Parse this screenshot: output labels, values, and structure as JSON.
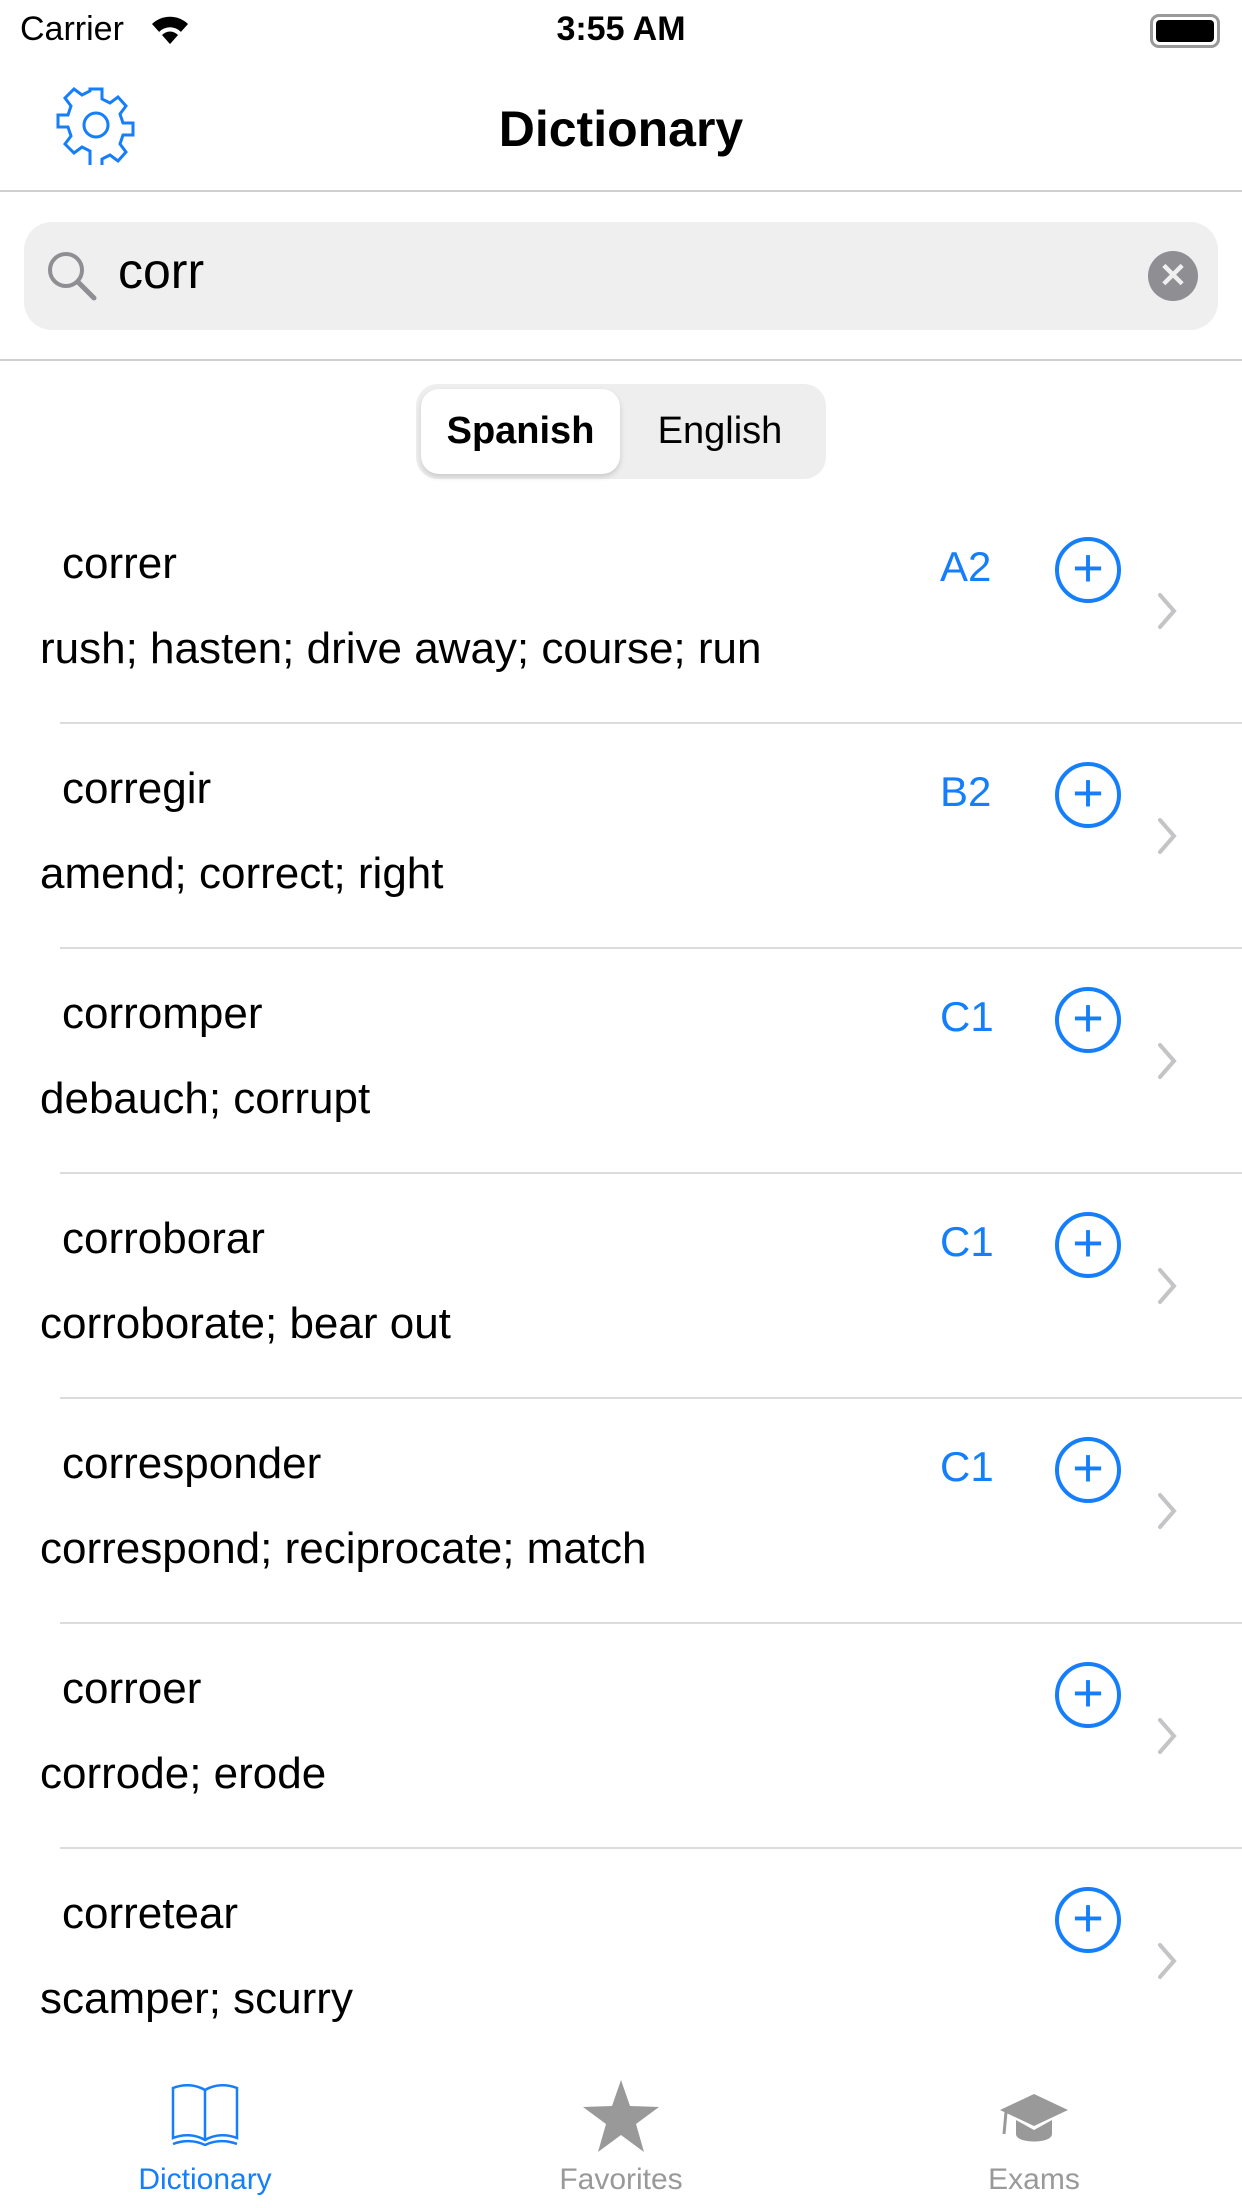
{
  "status": {
    "carrier": "Carrier",
    "time": "3:55 AM"
  },
  "nav": {
    "title": "Dictionary"
  },
  "search": {
    "value": "corr"
  },
  "segment": {
    "options": [
      "Spanish",
      "English"
    ],
    "selected": "Spanish"
  },
  "entries": [
    {
      "word": "correr",
      "definition": "rush; hasten; drive away; course; run",
      "level": "A2"
    },
    {
      "word": "corregir",
      "definition": "amend; correct; right",
      "level": "B2"
    },
    {
      "word": "corromper",
      "definition": "debauch; corrupt",
      "level": "C1"
    },
    {
      "word": "corroborar",
      "definition": "corroborate; bear out",
      "level": "C1"
    },
    {
      "word": "corresponder",
      "definition": "correspond; reciprocate; match",
      "level": "C1"
    },
    {
      "word": "corroer",
      "definition": "corrode; erode",
      "level": ""
    },
    {
      "word": "corretear",
      "definition": "scamper; scurry",
      "level": ""
    }
  ],
  "tabs": [
    {
      "label": "Dictionary",
      "icon": "book-icon",
      "active": true
    },
    {
      "label": "Favorites",
      "icon": "star-icon"
    },
    {
      "label": "Exams",
      "icon": "graduation-cap-icon"
    }
  ],
  "colors": {
    "accent": "#147efb",
    "inactive": "#999999"
  }
}
